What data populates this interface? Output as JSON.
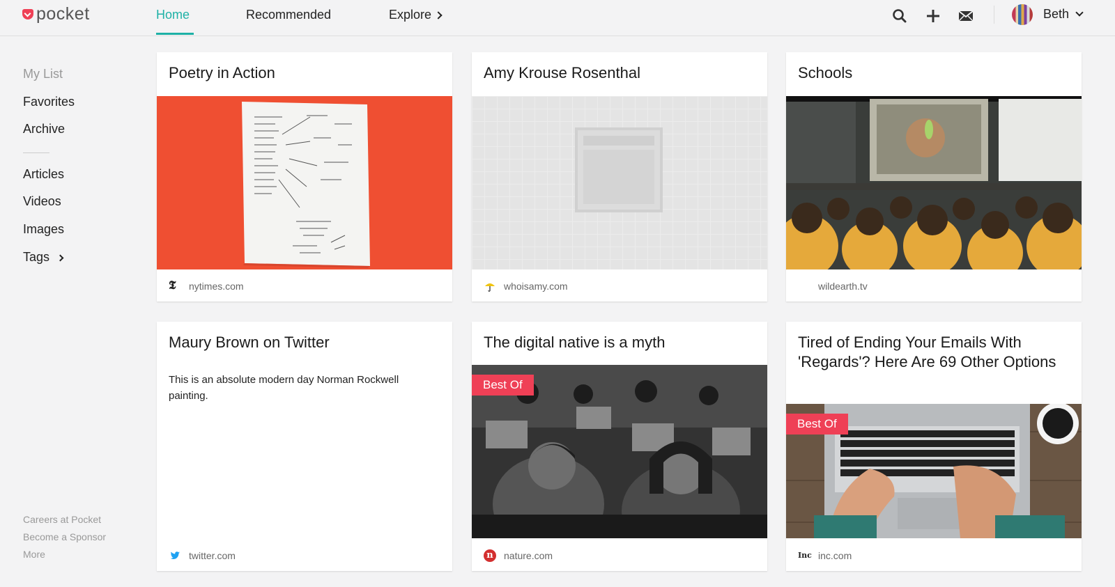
{
  "brand": {
    "name": "pocket"
  },
  "nav": {
    "home": "Home",
    "recommended": "Recommended",
    "explore": "Explore"
  },
  "user": {
    "name": "Beth"
  },
  "header_icons": [
    "search-icon",
    "add-icon",
    "mail-icon"
  ],
  "sidebar": {
    "items": [
      {
        "label": "My List",
        "muted": true
      },
      {
        "label": "Favorites"
      },
      {
        "label": "Archive"
      },
      {
        "label": "Articles"
      },
      {
        "label": "Videos"
      },
      {
        "label": "Images"
      },
      {
        "label": "Tags"
      }
    ],
    "footer": [
      "Careers at Pocket",
      "Become a Sponsor",
      "More"
    ]
  },
  "cards": [
    {
      "title": "Poetry in Action",
      "source": "nytimes.com",
      "source_icon": "nytimes-icon"
    },
    {
      "title": "Amy Krouse Rosenthal",
      "source": "whoisamy.com",
      "source_icon": "umbrella-icon"
    },
    {
      "title": "Schools",
      "source": "wildearth.tv",
      "source_icon": ""
    },
    {
      "title": "Maury Brown on Twitter",
      "excerpt": "This is an absolute modern day Norman Rockwell painting.",
      "source": "twitter.com",
      "source_icon": "twitter-icon"
    },
    {
      "title": "The digital native is a myth",
      "badge": "Best Of",
      "source": "nature.com",
      "source_icon": "nature-icon"
    },
    {
      "title": "Tired of Ending Your Emails With 'Regards'? Here Are 69 Other Options",
      "badge": "Best Of",
      "source": "inc.com",
      "source_icon": "inc-icon"
    }
  ],
  "colors": {
    "accent": "#1eb1a6",
    "brand": "#ef4056",
    "badge": "#ef4056",
    "poetry_bg": "#ef4f32"
  }
}
